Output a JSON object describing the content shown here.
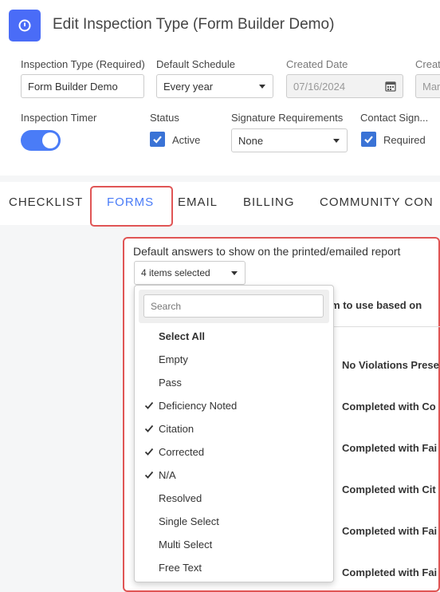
{
  "header": {
    "title": "Edit Inspection Type (Form Builder Demo)"
  },
  "fields": {
    "inspection_type_label": "Inspection Type (Required)",
    "inspection_type_value": "Form Builder Demo",
    "default_schedule_label": "Default Schedule",
    "default_schedule_value": "Every year",
    "created_date_label": "Created Date",
    "created_date_value": "07/16/2024",
    "cutoff_label": "Creat",
    "cutoff_value": "Mar",
    "inspection_timer_label": "Inspection Timer",
    "status_label": "Status",
    "status_value": "Active",
    "signature_label": "Signature Requirements",
    "signature_value": "None",
    "contact_sign_label": "Contact Sign...",
    "contact_sign_value": "Required"
  },
  "tabs": [
    "CHECKLIST",
    "FORMS",
    "EMAIL",
    "BILLING",
    "COMMUNITY CON"
  ],
  "active_tab": "FORMS",
  "forms": {
    "default_answers_label": "Default answers to show on the printed/emailed report",
    "selection_summary": "4 items selected",
    "background_header": "rm to use based on",
    "background_rows": [
      "No Violations Prese",
      "Completed with Co",
      "Completed with Fai",
      "Completed with Cit",
      "Completed with Fai",
      "Completed with Fai"
    ]
  },
  "dropdown": {
    "search_placeholder": "Search",
    "select_all": "Select All",
    "options": [
      {
        "label": "Empty",
        "checked": false
      },
      {
        "label": "Pass",
        "checked": false
      },
      {
        "label": "Deficiency Noted",
        "checked": true
      },
      {
        "label": "Citation",
        "checked": true
      },
      {
        "label": "Corrected",
        "checked": true
      },
      {
        "label": "N/A",
        "checked": true
      },
      {
        "label": "Resolved",
        "checked": false
      },
      {
        "label": "Single Select",
        "checked": false
      },
      {
        "label": "Multi Select",
        "checked": false
      },
      {
        "label": "Free Text",
        "checked": false
      }
    ]
  },
  "colors": {
    "accent": "#4a7cf7",
    "checkbox": "#3a73d6",
    "highlight": "#e05555"
  }
}
